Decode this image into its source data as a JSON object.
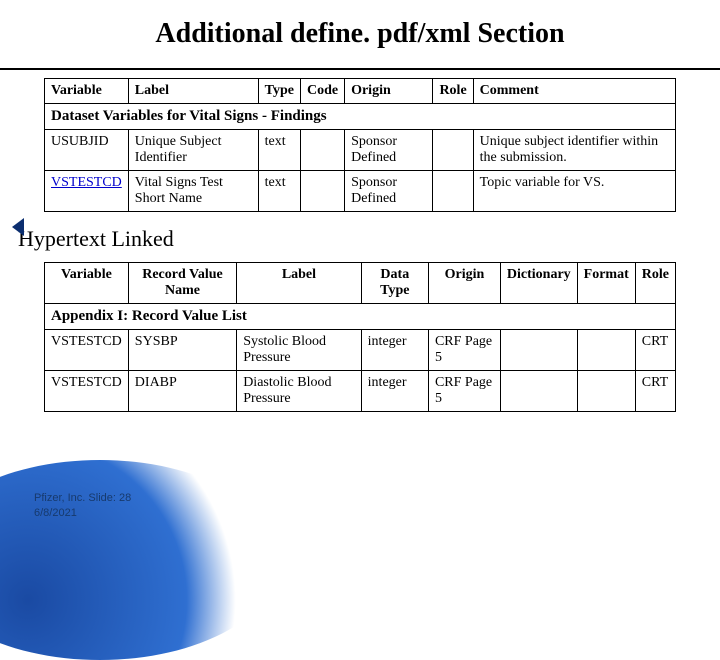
{
  "title": "Additional define. pdf/xml Section",
  "table1": {
    "caption": "Dataset Variables for Vital Signs - Findings",
    "headers": [
      "Variable",
      "Label",
      "Type",
      "Code",
      "Origin",
      "Role",
      "Comment"
    ],
    "rows": [
      {
        "variable": "USUBJID",
        "label": "Unique Subject Identifier",
        "type": "text",
        "code": "",
        "origin": "Sponsor Defined",
        "role": "",
        "comment": "Unique subject identifier within the submission."
      },
      {
        "variable": "VSTESTCD",
        "variable_link": true,
        "label": "Vital Signs Test Short Name",
        "type": "text",
        "code": "",
        "origin": "Sponsor Defined",
        "role": "",
        "comment": "Topic variable for VS."
      }
    ]
  },
  "subhead": "Hypertext Linked",
  "table2": {
    "caption": "Appendix I: Record Value List",
    "headers": [
      "Variable",
      "Record Value Name",
      "Label",
      "Data Type",
      "Origin",
      "Dictionary",
      "Format",
      "Role"
    ],
    "rows": [
      {
        "variable": "VSTESTCD",
        "record_value": "SYSBP",
        "label": "Systolic Blood Pressure",
        "data_type": "integer",
        "origin": "CRF Page 5",
        "dictionary": "",
        "format": "",
        "role": "CRT"
      },
      {
        "variable": "VSTESTCD",
        "record_value": "DIABP",
        "label": "Diastolic Blood Pressure",
        "data_type": "integer",
        "origin": "CRF Page 5",
        "dictionary": "",
        "format": "",
        "role": "CRT"
      }
    ]
  },
  "footer": {
    "line1": "Pfizer, Inc. Slide: 28",
    "line2": "6/8/2021"
  }
}
